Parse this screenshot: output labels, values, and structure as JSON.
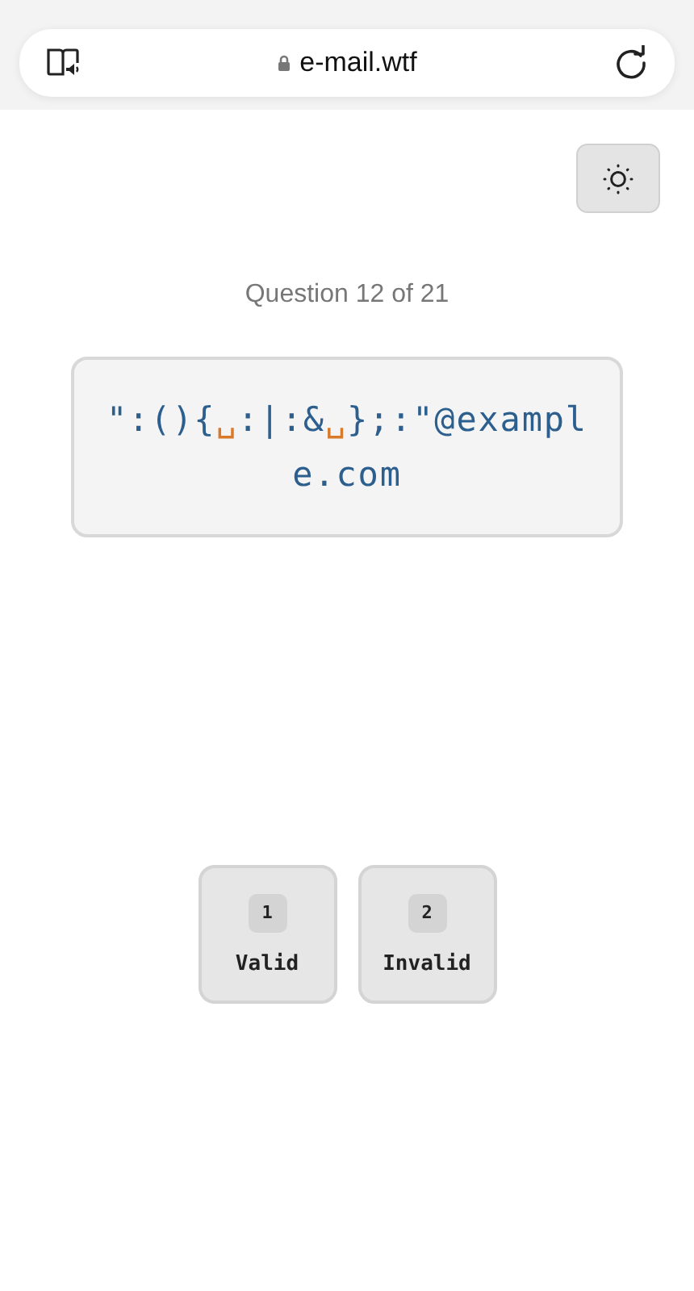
{
  "browser": {
    "url": "e-mail.wtf",
    "secure": true
  },
  "progress": "Question 12 of 21",
  "email": [
    {
      "kind": "text",
      "text": "\":(){"
    },
    {
      "kind": "space",
      "text": "␣"
    },
    {
      "kind": "text",
      "text": ":|:&"
    },
    {
      "kind": "space",
      "text": "␣"
    },
    {
      "kind": "text",
      "text": "};:\"@example.com"
    }
  ],
  "answers": [
    {
      "key": "1",
      "label": "Valid"
    },
    {
      "key": "2",
      "label": "Invalid"
    }
  ]
}
